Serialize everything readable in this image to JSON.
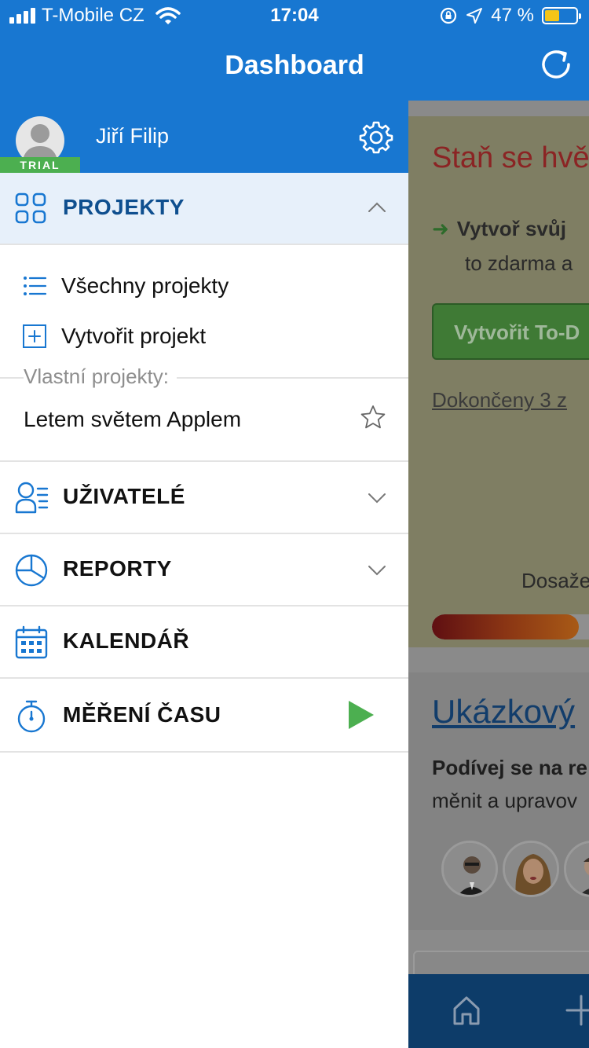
{
  "status_bar": {
    "carrier": "T-Mobile CZ",
    "time": "17:04",
    "battery_pct": "47 %",
    "battery_level": 0.47
  },
  "nav": {
    "title": "Dashboard"
  },
  "profile": {
    "name": "Jiří Filip",
    "badge": "TRIAL"
  },
  "drawer": {
    "projekty": {
      "label": "PROJEKTY",
      "items": [
        {
          "label": "Všechny projekty",
          "icon": "list-icon"
        },
        {
          "label": "Vytvořit projekt",
          "icon": "plus-box-icon"
        }
      ],
      "own_projects_label": "Vlastní projekty:",
      "own_projects": [
        {
          "name": "Letem světem Applem",
          "icon": "star-icon"
        }
      ]
    },
    "sections": [
      {
        "label": "UŽIVATELÉ",
        "icon": "users-icon"
      },
      {
        "label": "REPORTY",
        "icon": "pie-chart-icon"
      },
      {
        "label": "KALENDÁŘ",
        "icon": "calendar-icon"
      },
      {
        "label": "MĚŘENÍ ČASU",
        "icon": "stopwatch-icon"
      }
    ]
  },
  "background": {
    "promo_title": "Staň se hvě",
    "promo_line1": "Vytvoř svůj",
    "promo_line2": "to zdarma a",
    "promo_button": "Vytvořit To-D",
    "promo_link": "Dokončeny 3 z",
    "progress_label": "Dosaže",
    "progress_level": 0.78,
    "sample_title": "Ukázkový",
    "sample_bold": "Podívej se na re",
    "sample_text": "měnit a upravov"
  },
  "colors": {
    "primary": "#1877d1",
    "active_section_bg": "#e7f0fa",
    "trial_badge": "#4caf50",
    "play": "#4caf50"
  }
}
